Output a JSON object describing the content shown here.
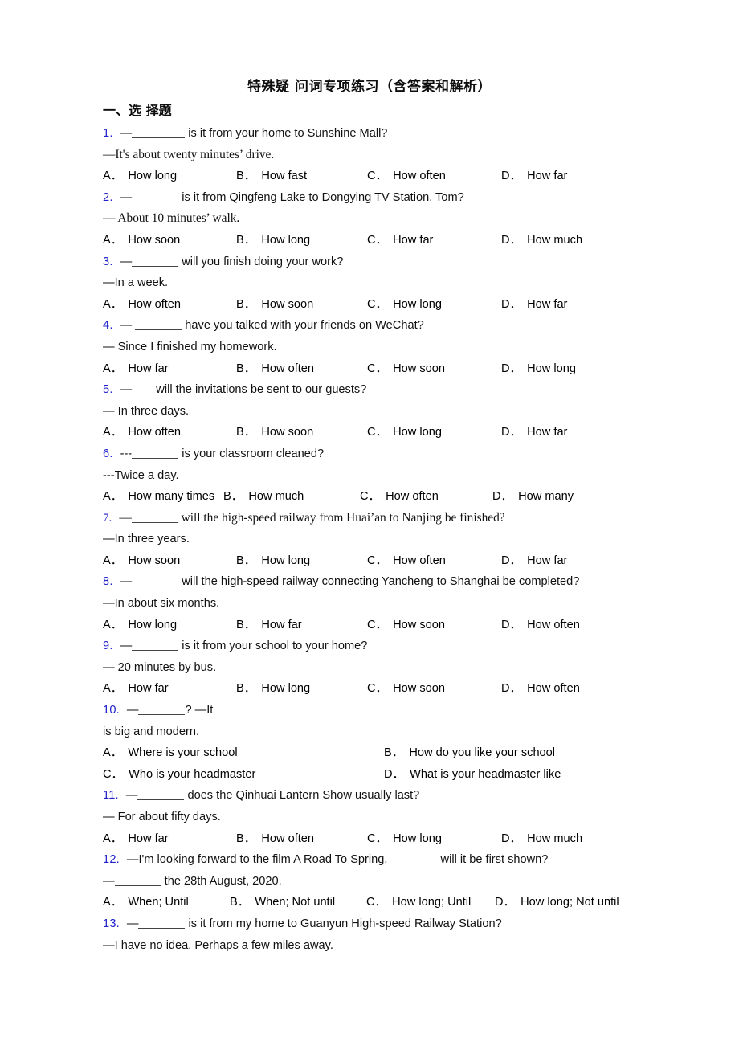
{
  "document": {
    "title": "特殊疑 问词专项练习（含答案和解析）",
    "section_heading": "一、选 择题"
  },
  "questions": [
    {
      "number": "1.",
      "stem_pre": "—",
      "blank": "lg",
      "stem_post": " is it from your home to Sunshine Mall?",
      "answer": "—It's about twenty minutes’ drive.",
      "answer_style": "serif",
      "stem_style": "sans",
      "layout": "std",
      "options": [
        {
          "letter": "A．",
          "text": "How long"
        },
        {
          "letter": "B．",
          "text": "How fast"
        },
        {
          "letter": "C．",
          "text": "How often"
        },
        {
          "letter": "D．",
          "text": "How far"
        }
      ]
    },
    {
      "number": "2.",
      "stem_pre": "—",
      "blank": "md",
      "stem_post": " is it from Qingfeng Lake to Dongying TV Station, Tom?",
      "answer": "— About 10 minutes’ walk.",
      "answer_style": "serif",
      "stem_style": "sans",
      "layout": "std",
      "options": [
        {
          "letter": "A．",
          "text": "How soon"
        },
        {
          "letter": "B．",
          "text": "How long"
        },
        {
          "letter": "C．",
          "text": "How far"
        },
        {
          "letter": "D．",
          "text": "How much"
        }
      ]
    },
    {
      "number": "3.",
      "stem_pre": "—",
      "blank": "md",
      "stem_post": " will you finish doing your work?",
      "answer": "—In a week.",
      "answer_style": "sans",
      "stem_style": "sans",
      "layout": "std",
      "options": [
        {
          "letter": "A．",
          "text": "How often"
        },
        {
          "letter": "B．",
          "text": "How soon"
        },
        {
          "letter": "C．",
          "text": "How long"
        },
        {
          "letter": "D．",
          "text": "How far"
        }
      ]
    },
    {
      "number": "4.",
      "stem_pre": "— ",
      "blank": "md",
      "stem_post": " have you talked with your friends on WeChat?",
      "answer": "— Since I finished my homework.",
      "answer_style": "sans",
      "stem_style": "sans",
      "layout": "std",
      "options": [
        {
          "letter": "A．",
          "text": "How far"
        },
        {
          "letter": "B．",
          "text": "How often"
        },
        {
          "letter": "C．",
          "text": "How soon"
        },
        {
          "letter": "D．",
          "text": "How long"
        }
      ]
    },
    {
      "number": "5.",
      "stem_pre": "— ",
      "blank": "sm",
      "stem_post": " will the invitations be sent to our guests?",
      "answer": "— In three days.",
      "answer_style": "sans",
      "stem_style": "sans",
      "layout": "std",
      "options": [
        {
          "letter": "A．",
          "text": "How often"
        },
        {
          "letter": "B．",
          "text": "How soon"
        },
        {
          "letter": "C．",
          "text": "How long"
        },
        {
          "letter": "D．",
          "text": "How far"
        }
      ]
    },
    {
      "number": "6.",
      "stem_pre": "---",
      "blank": "md",
      "stem_post": " is your classroom cleaned?",
      "answer": "---Twice a day.",
      "answer_style": "sans",
      "stem_style": "sans",
      "layout": "tight",
      "options": [
        {
          "letter": "A．",
          "text": "How many times"
        },
        {
          "letter": "B．",
          "text": "How much"
        },
        {
          "letter": "C．",
          "text": "How often"
        },
        {
          "letter": "D．",
          "text": "How many"
        }
      ]
    },
    {
      "number": "7.",
      "stem_pre": "—",
      "blank": "md",
      "stem_post": " will the high-speed railway from Huai’an to Nanjing be finished?",
      "answer": "—In three years.",
      "answer_style": "sans",
      "stem_style": "serif",
      "layout": "std",
      "options": [
        {
          "letter": "A．",
          "text": "How soon"
        },
        {
          "letter": "B．",
          "text": "How long"
        },
        {
          "letter": "C．",
          "text": "How often"
        },
        {
          "letter": "D．",
          "text": "How far"
        }
      ]
    },
    {
      "number": "8.",
      "stem_pre": "—",
      "blank": "md",
      "stem_post": " will the high-speed railway connecting Yancheng to Shanghai be completed?",
      "answer": "—In about six months.",
      "answer_style": "sans",
      "stem_style": "sans",
      "layout": "std",
      "options": [
        {
          "letter": "A．",
          "text": "How long"
        },
        {
          "letter": "B．",
          "text": "How far"
        },
        {
          "letter": "C．",
          "text": "How soon"
        },
        {
          "letter": "D．",
          "text": "How often"
        }
      ]
    },
    {
      "number": "9.",
      "stem_pre": "—",
      "blank": "md",
      "stem_post": " is it from your school to your home?",
      "answer": "— 20 minutes by bus.",
      "answer_style": "sans",
      "stem_style": "sans",
      "layout": "std",
      "options": [
        {
          "letter": "A．",
          "text": "How far"
        },
        {
          "letter": "B．",
          "text": "How long"
        },
        {
          "letter": "C．",
          "text": "How soon"
        },
        {
          "letter": "D．",
          "text": "How often"
        }
      ]
    },
    {
      "number": "10.",
      "stem_pre": "—",
      "blank": "md",
      "stem_post": "?  —It",
      "answer": "is big and modern.",
      "answer_style": "sans",
      "answer_noindent": true,
      "stem_style": "sans",
      "layout": "two",
      "options": [
        {
          "letter": "A．",
          "text": "Where is your school"
        },
        {
          "letter": "B．",
          "text": "How do you like your school"
        },
        {
          "letter": "C．",
          "text": "Who is your headmaster"
        },
        {
          "letter": "D．",
          "text": "What is your headmaster like"
        }
      ]
    },
    {
      "number": "11.",
      "stem_pre": "—",
      "blank": "md",
      "stem_post": " does the Qinhuai Lantern Show usually last?",
      "answer": "— For about fifty days.",
      "answer_style": "sans",
      "stem_style": "sans",
      "layout": "std",
      "options": [
        {
          "letter": "A．",
          "text": "How far"
        },
        {
          "letter": "B．",
          "text": "How often"
        },
        {
          "letter": "C．",
          "text": "How long"
        },
        {
          "letter": "D．",
          "text": "How much"
        }
      ]
    },
    {
      "number": "12.",
      "stem_pre": "—I'm looking forward to the film A Road To Spring. ",
      "blank": "md",
      "stem_post": " will it be first shown?",
      "answer_pre": "—",
      "answer_blank": "md",
      "answer_post": " the 28th August, 2020.",
      "answer_style": "sans",
      "stem_style": "sans",
      "layout": "tight12",
      "options": [
        {
          "letter": "A．",
          "text": "When; Until"
        },
        {
          "letter": "B．",
          "text": "When; Not until"
        },
        {
          "letter": "C．",
          "text": "How long; Until"
        },
        {
          "letter": "D．",
          "text": "How long; Not until"
        }
      ]
    },
    {
      "number": "13.",
      "stem_pre": "—",
      "blank": "md",
      "stem_post": " is it from my home to Guanyun High-speed Railway Station?",
      "answer": "—I have no idea. Perhaps a few miles away.",
      "answer_style": "sans",
      "stem_style": "sans",
      "layout": "none",
      "options": []
    }
  ],
  "colors": {
    "question_number": "#2222cc",
    "body_text": "#111111",
    "page_background": "#ffffff"
  }
}
